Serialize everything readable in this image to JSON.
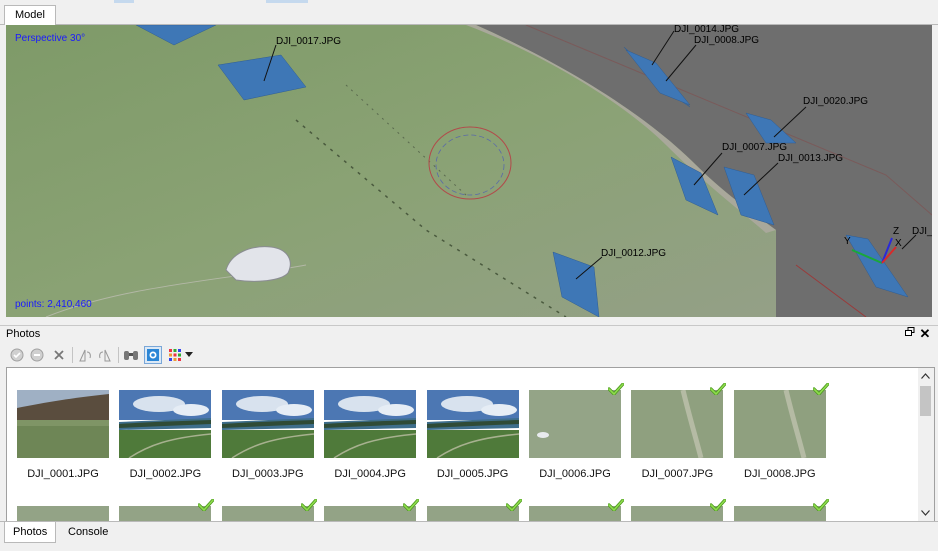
{
  "model_tab": {
    "label": "Model"
  },
  "viewport": {
    "projection": "Perspective 30°",
    "points": "points: 2,410,460",
    "cameras": [
      {
        "label": "DJI_0017.JPG"
      },
      {
        "label": "DJI_0014.JPG"
      },
      {
        "label": "DJI_0008.JPG"
      },
      {
        "label": "DJI_0020.JPG"
      },
      {
        "label": "DJI_0007.JPG"
      },
      {
        "label": "DJI_0013.JPG"
      },
      {
        "label": "DJI_0012.JPG"
      },
      {
        "label": "DJI_"
      }
    ],
    "axes": {
      "x": "X",
      "y": "Y",
      "z": "Z"
    }
  },
  "photos_pane": {
    "title": "Photos",
    "float_icon": "restore-icon",
    "close_icon": "close-icon",
    "toolbar": [
      "enable-cameras-icon",
      "disable-cameras-icon",
      "remove-cameras-icon",
      "rotate-left-icon",
      "rotate-right-icon",
      "binoculars-icon",
      "show-cameras-icon",
      "view-mode-grid-icon"
    ],
    "items": [
      {
        "label": "DJI_0001.JPG",
        "kind": "landscape-hill",
        "aligned": false
      },
      {
        "label": "DJI_0002.JPG",
        "kind": "landscape-lake",
        "aligned": false
      },
      {
        "label": "DJI_0003.JPG",
        "kind": "landscape-lake",
        "aligned": false
      },
      {
        "label": "DJI_0004.JPG",
        "kind": "landscape-lake",
        "aligned": false
      },
      {
        "label": "DJI_0005.JPG",
        "kind": "landscape-lake",
        "aligned": false
      },
      {
        "label": "DJI_0006.JPG",
        "kind": "aerial-rock",
        "aligned": true
      },
      {
        "label": "DJI_0007.JPG",
        "kind": "aerial-track",
        "aligned": true
      },
      {
        "label": "DJI_0008.JPG",
        "kind": "aerial-track",
        "aligned": true
      }
    ],
    "row2_aligned": [
      false,
      true,
      true,
      true,
      true,
      true,
      true,
      true
    ]
  },
  "bottom_tabs": [
    "Photos",
    "Console"
  ],
  "colors": {
    "camera_plane": "#3e77b6",
    "check_green": "#6cbe2e",
    "background_gray": "#6e6e6e",
    "overlay_text": "#1a1aff"
  }
}
